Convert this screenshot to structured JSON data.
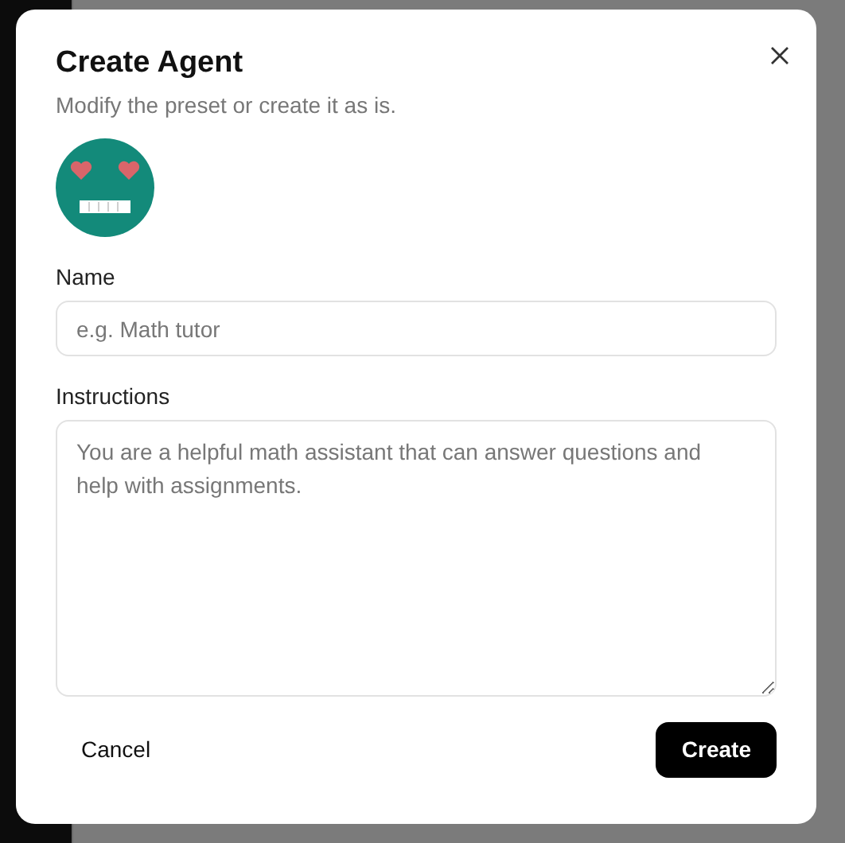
{
  "dialog": {
    "title": "Create Agent",
    "subtitle": "Modify the preset or create it as is.",
    "fields": [
      {
        "kind": "input",
        "label": "Name",
        "placeholder": "e.g. Math tutor"
      },
      {
        "kind": "textarea",
        "label": "Instructions",
        "placeholder": "You are a helpful math assistant that can answer questions and help with assignments."
      }
    ],
    "buttons": [
      {
        "label": "Cancel",
        "kind": "ghost"
      },
      {
        "label": "Create",
        "kind": "primary"
      }
    ]
  }
}
